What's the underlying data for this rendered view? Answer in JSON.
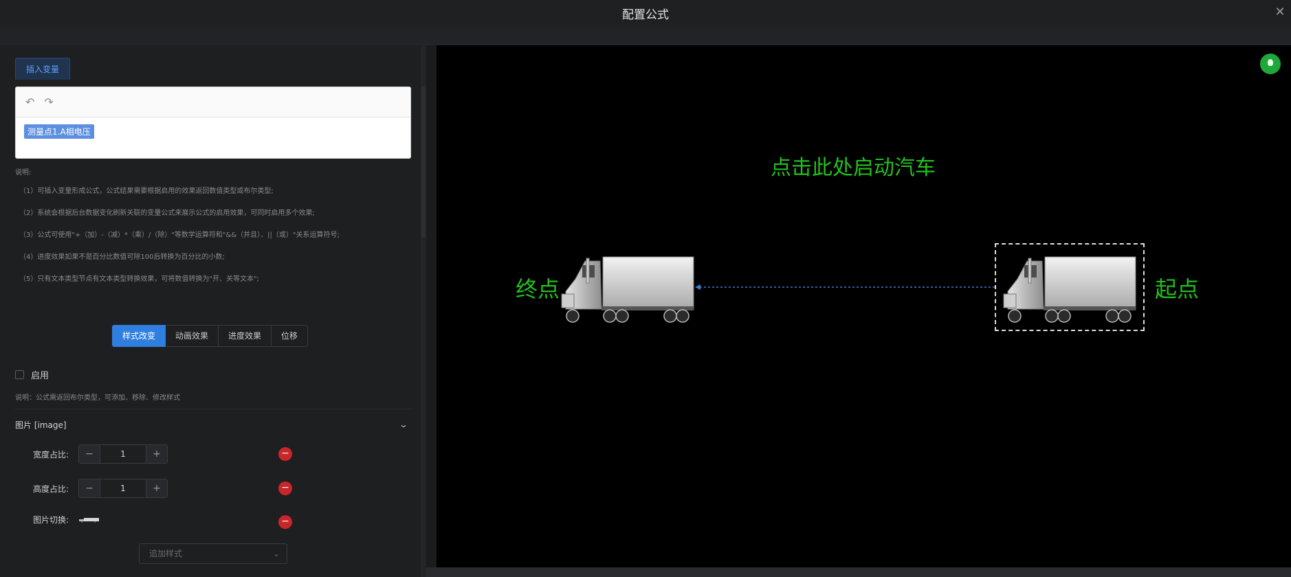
{
  "window": {
    "title": "配置公式",
    "close_icon": "close-icon"
  },
  "editor": {
    "insert_tab_label": "插入变量",
    "undo_icon": "undo-icon",
    "redo_icon": "redo-icon",
    "variable_chip": "测量点1.A相电压"
  },
  "notes": {
    "heading": "说明:",
    "lines": [
      "（1）可插入变量形成公式，公式结果需要根据启用的效果返回数值类型或布尔类型;",
      "（2）系统会根据后台数据变化刷新关联的变量公式来展示公式的启用效果，可同时启用多个效果;",
      "（3）公式可使用\"+（加）-（减）*（乘）/（除）\"等数学运算符和\"&&（并且）、||（或）\"关系运算符号;",
      "（4）进度效果如果不是百分比数值可除100后转换为百分比的小数;",
      "（5）只有文本类型节点有文本类型转换效果，可将数值转换为\"开、关等文本\";"
    ]
  },
  "effect_tabs": {
    "items": [
      "样式改变",
      "动画效果",
      "进度效果",
      "位移"
    ],
    "active_index": 0
  },
  "enable": {
    "label": "启用",
    "checked": false,
    "note": "说明：公式需返回布尔类型，可添加、移除、修改样式"
  },
  "style_section": {
    "title": "图片 [image]",
    "chevron_icon": "chevron-down-icon",
    "width_ratio": {
      "label": "宽度占比:",
      "value": "1"
    },
    "height_ratio": {
      "label": "高度占比:",
      "value": "1"
    },
    "image_switch": {
      "label": "图片切换:"
    },
    "minus_symbol": "−",
    "plus_symbol": "+",
    "remove_icon": "remove-icon",
    "add_style_placeholder": "追加样式"
  },
  "canvas": {
    "start_button_text": "点击此处启动汽车",
    "end_label": "终点",
    "start_label": "起点",
    "bulb_icon": "lightbulb-icon",
    "colors": {
      "text_green": "#22c11d",
      "path_blue": "#3d7fd6",
      "bulb_green": "#1fa83a"
    }
  }
}
